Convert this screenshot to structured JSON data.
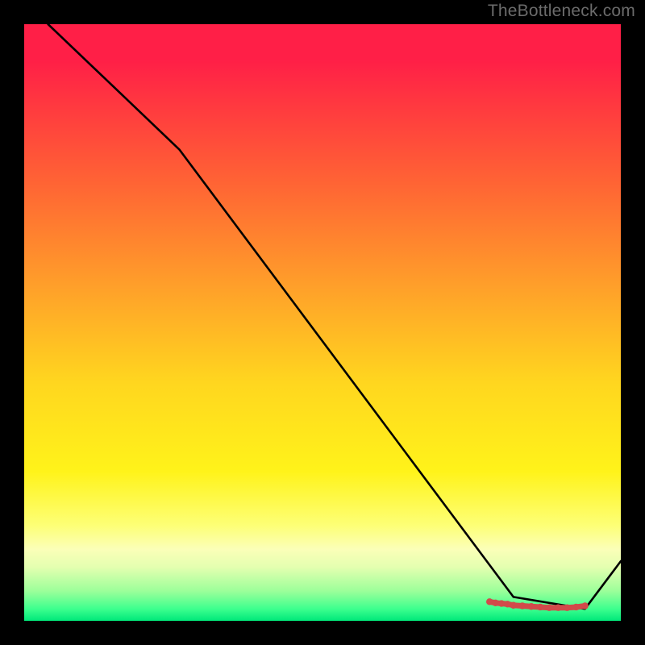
{
  "attribution": "TheBottleneck.com",
  "chart_data": {
    "type": "line",
    "title": "",
    "xlabel": "",
    "ylabel": "",
    "xlim": [
      0,
      100
    ],
    "ylim": [
      0,
      100
    ],
    "grid": false,
    "legend": false,
    "series": [
      {
        "name": "main-line",
        "color": "#000000",
        "x": [
          4,
          26,
          82,
          94,
          100
        ],
        "y": [
          100,
          79,
          4,
          2,
          10
        ]
      },
      {
        "name": "marker-band",
        "color": "#d24a4a",
        "x": [
          78,
          79,
          80,
          81,
          82,
          83.5,
          85,
          86.5,
          88,
          89.5,
          91,
          92.5,
          94
        ],
        "y": [
          3.2,
          3.0,
          2.9,
          2.8,
          2.6,
          2.5,
          2.4,
          2.3,
          2.2,
          2.2,
          2.2,
          2.3,
          2.5
        ]
      }
    ],
    "gradient_stops": [
      {
        "pos": 0,
        "color": "#ff1f47"
      },
      {
        "pos": 6,
        "color": "#ff1f47"
      },
      {
        "pos": 14,
        "color": "#ff3a3f"
      },
      {
        "pos": 27,
        "color": "#ff6534"
      },
      {
        "pos": 45,
        "color": "#ffa329"
      },
      {
        "pos": 60,
        "color": "#ffd61f"
      },
      {
        "pos": 75,
        "color": "#fff31a"
      },
      {
        "pos": 84,
        "color": "#fdff76"
      },
      {
        "pos": 88,
        "color": "#fbffb8"
      },
      {
        "pos": 91,
        "color": "#e4ffb0"
      },
      {
        "pos": 95,
        "color": "#9cff9a"
      },
      {
        "pos": 98,
        "color": "#3dff8e"
      },
      {
        "pos": 100,
        "color": "#00e87a"
      }
    ]
  },
  "colors": {
    "frame": "#000000",
    "line": "#000000",
    "marker": "#d24a4a",
    "attribution_text": "#6b6b6b"
  }
}
